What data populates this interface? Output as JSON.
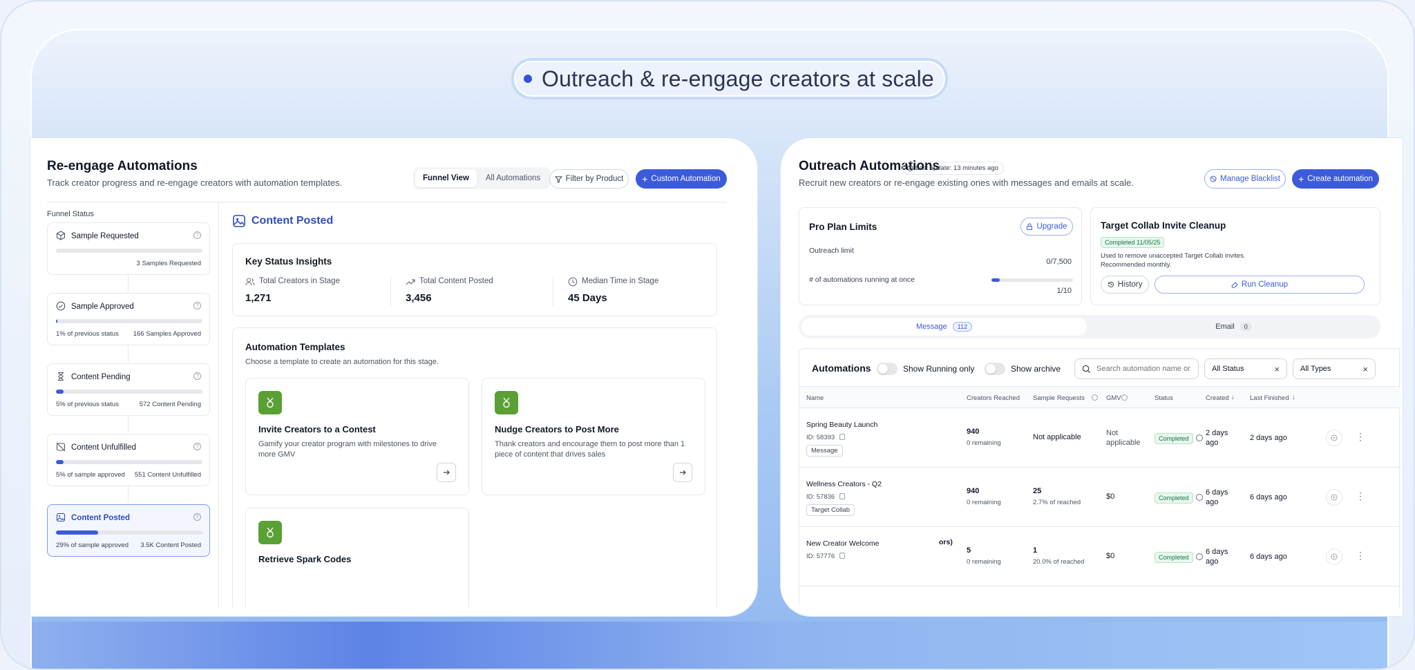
{
  "headline": {
    "text": "Outreach & re-engage creators at scale"
  },
  "left": {
    "title": "Re-engage Automations",
    "subtitle": "Track creator progress and re-engage creators with automation templates.",
    "views": [
      {
        "label": "Funnel View",
        "active": true
      },
      {
        "label": "All Automations",
        "active": false
      }
    ],
    "filter_label": "Filter by Product",
    "custom_label": "Custom Automation",
    "funnel_heading": "Funnel Status",
    "funnel": [
      {
        "name": "Sample Requested",
        "icon": "package-icon",
        "progress": 0,
        "left": "",
        "right": "3 Samples Requested",
        "active": false
      },
      {
        "name": "Sample Approved",
        "icon": "check-circle-icon",
        "progress": 1,
        "left": "1% of previous status",
        "right": "166 Samples Approved",
        "active": false
      },
      {
        "name": "Content Pending",
        "icon": "hourglass-icon",
        "progress": 5,
        "left": "5% of previous status",
        "right": "572 Content Pending",
        "active": false
      },
      {
        "name": "Content Unfulfilled",
        "icon": "image-off-icon",
        "progress": 5,
        "left": "5% of sample approved",
        "right": "551 Content Unfulfilled",
        "active": false
      },
      {
        "name": "Content Posted",
        "icon": "image-icon",
        "progress": 29,
        "left": "29% of sample approved",
        "right": "3.5K Content Posted",
        "active": true
      }
    ],
    "section_title": "Content Posted",
    "insights": {
      "title": "Key Status Insights",
      "stats": [
        {
          "label": "Total Creators in Stage",
          "value": "1,271",
          "icon": "users-icon"
        },
        {
          "label": "Total Content Posted",
          "value": "3,456",
          "icon": "trend-up-icon"
        },
        {
          "label": "Median Time in Stage",
          "value": "45 Days",
          "icon": "clock-icon"
        }
      ]
    },
    "templates": {
      "title": "Automation Templates",
      "subtitle": "Choose a template to create an automation for this stage.",
      "items": [
        {
          "title": "Invite Creators to a Contest",
          "desc": "Gamify your creator program with milestones to drive more GMV"
        },
        {
          "title": "Nudge Creators to Post More",
          "desc": "Thank creators and encourage them to post more than 1 piece of content that drives sales"
        },
        {
          "title": "Retrieve Spark Codes",
          "desc": ""
        }
      ]
    }
  },
  "right": {
    "title": "Outreach Automations",
    "last_update": "Last update: 13 minutes ago",
    "subtitle": "Recruit new creators or re-engage existing ones with messages and emails at scale.",
    "blacklist_label": "Manage Blacklist",
    "create_label": "Create automation",
    "plan": {
      "title": "Pro Plan Limits",
      "upgrade_label": "Upgrade",
      "outreach_label": "Outreach limit",
      "outreach_value": "0/7,500",
      "outreach_progress": 0,
      "running_label": "# of automations running at once",
      "running_value": "1/10",
      "running_progress": 10
    },
    "cleanup": {
      "title": "Target Collab Invite Cleanup",
      "badge": "Completed 11/05/25",
      "desc1": "Used to remove unaccepted Target Collab invites.",
      "desc2": "Recommended monthly.",
      "history_label": "History",
      "run_label": "Run Cleanup"
    },
    "tabs": [
      {
        "label": "Message",
        "count": "112",
        "active": true
      },
      {
        "label": "Email",
        "count": "0",
        "active": false
      }
    ],
    "automations": {
      "title": "Automations",
      "running_only": "Show Running only",
      "archive": "Show archive",
      "search_placeholder": "Search automation name or",
      "status_filter": "All Status",
      "type_filter": "All Types",
      "columns": [
        "Name",
        "Creators Reached",
        "Sample Requests",
        "GMV",
        "Status",
        "Created",
        "Last Finished"
      ],
      "rows": [
        {
          "name": "Spring Beauty Launch",
          "id": "ID: 58393",
          "tag": "Message",
          "reached": "940",
          "reached_sub": "0 remaining",
          "samples": "Not applicable",
          "samples_sub": "",
          "gmv1": "Not",
          "gmv2": "applicable",
          "status": "Completed",
          "created1": "2 days",
          "created2": "ago",
          "finished": "2 days ago"
        },
        {
          "name": "Wellness Creators - Q2",
          "id": "ID: 57836",
          "tag": "Target Collab",
          "reached": "940",
          "reached_sub": "0 remaining",
          "samples": "25",
          "samples_sub": "2.7% of reached",
          "gmv1": "$0",
          "gmv2": "",
          "status": "Completed",
          "created1": "6 days",
          "created2": "ago",
          "finished": "6 days ago"
        },
        {
          "name": "New Creator Welcome",
          "id": "ID: 57776",
          "tag": "",
          "reached": "5",
          "reached_sub": "0 remaining",
          "samples": "1",
          "samples_sub": "20.0% of reached",
          "gmv1": "$0",
          "gmv2": "",
          "status": "Completed",
          "created1": "6 days",
          "created2": "ago",
          "finished": "6 days ago"
        }
      ],
      "clipped_suffix": "ors)"
    }
  },
  "colors": {
    "primary": "#3b5bdb",
    "template_icon": "#5aa035",
    "completed": "#157347"
  }
}
